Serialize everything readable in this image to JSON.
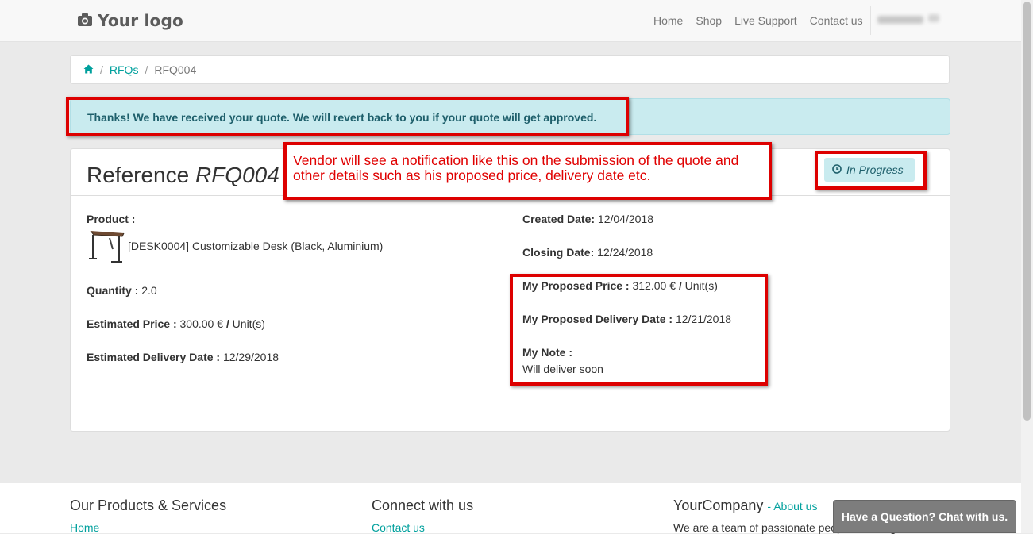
{
  "header": {
    "logo_text": "Your logo",
    "nav": [
      "Home",
      "Shop",
      "Live Support",
      "Contact us"
    ]
  },
  "breadcrumb": {
    "link": "RFQs",
    "current": "RFQ004"
  },
  "alert": {
    "text": "Thanks! We have received your quote. We will revert back to you if your quote will get approved."
  },
  "panel": {
    "title_prefix": "Reference",
    "title_ref": "RFQ004",
    "status": "In Progress",
    "left": {
      "product_label": "Product :",
      "product_name": "[DESK0004] Customizable Desk (Black, Aluminium)",
      "quantity_label": "Quantity :",
      "quantity_value": "2.0",
      "est_price_label": "Estimated Price :",
      "est_price_value": "300.00 €",
      "est_price_unit": "Unit(s)",
      "est_delivery_label": "Estimated Delivery Date :",
      "est_delivery_value": "12/29/2018"
    },
    "right": {
      "created_label": "Created Date:",
      "created_value": "12/04/2018",
      "closing_label": "Closing Date:",
      "closing_value": "12/24/2018",
      "proposed_price_label": "My Proposed Price :",
      "proposed_price_value": "312.00 €",
      "proposed_price_unit": "Unit(s)",
      "proposed_delivery_label": "My Proposed Delivery Date :",
      "proposed_delivery_value": "12/21/2018",
      "note_label": "My Note :",
      "note_value": "Will deliver soon"
    }
  },
  "annotation": {
    "text": "Vendor will see a notification like this on the submission of the quote and other details such as his proposed price, delivery date etc."
  },
  "footer": {
    "col1_title": "Our Products & Services",
    "col1_link": "Home",
    "col2_title": "Connect with us",
    "col2_link": "Contact us",
    "col3_title": "YourCompany",
    "col3_about": "About us",
    "col3_text": "We are a team of passionate people whose goal is to"
  },
  "chat": {
    "label": "Have a Question? Chat with us."
  },
  "colors": {
    "accent": "#00a09d",
    "alert_bg": "#c9ebef",
    "annotation_red": "#dd0000"
  }
}
